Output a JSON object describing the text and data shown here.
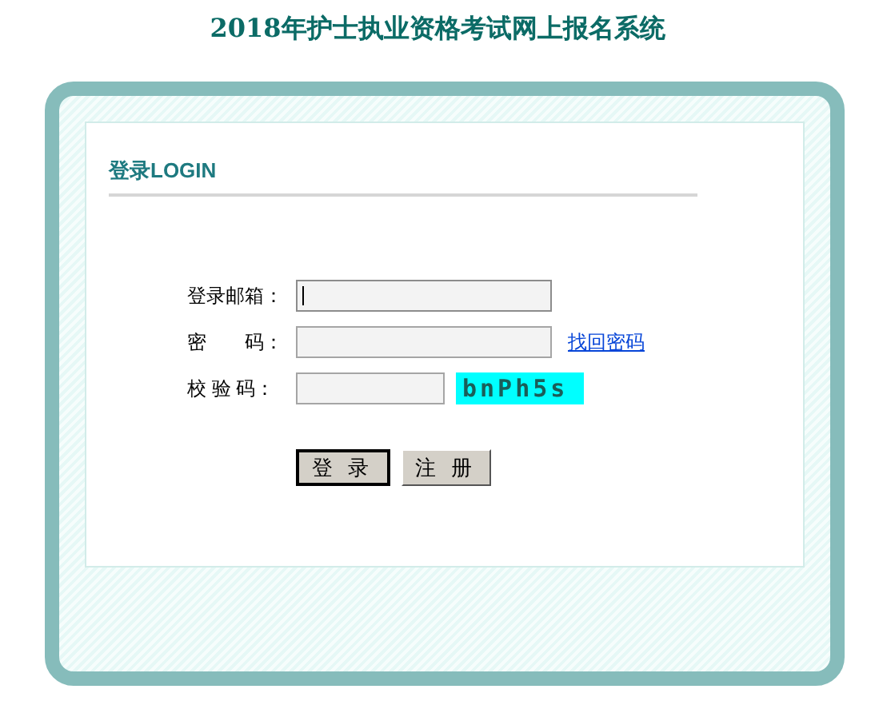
{
  "title": "2018年护士执业资格考试网上报名系统",
  "login": {
    "heading": "登录LOGIN",
    "fields": [
      {
        "kind": "text",
        "label": "登录邮箱：",
        "focused": true
      },
      {
        "kind": "password",
        "label": "密　　码：",
        "focused": false,
        "link": "找回密码"
      },
      {
        "kind": "captcha",
        "label": "校 验 码：",
        "focused": false,
        "captcha": "bnPh5s"
      }
    ],
    "buttons": [
      {
        "label": "登 录",
        "selected": true
      },
      {
        "label": "注 册",
        "selected": false
      }
    ]
  }
}
